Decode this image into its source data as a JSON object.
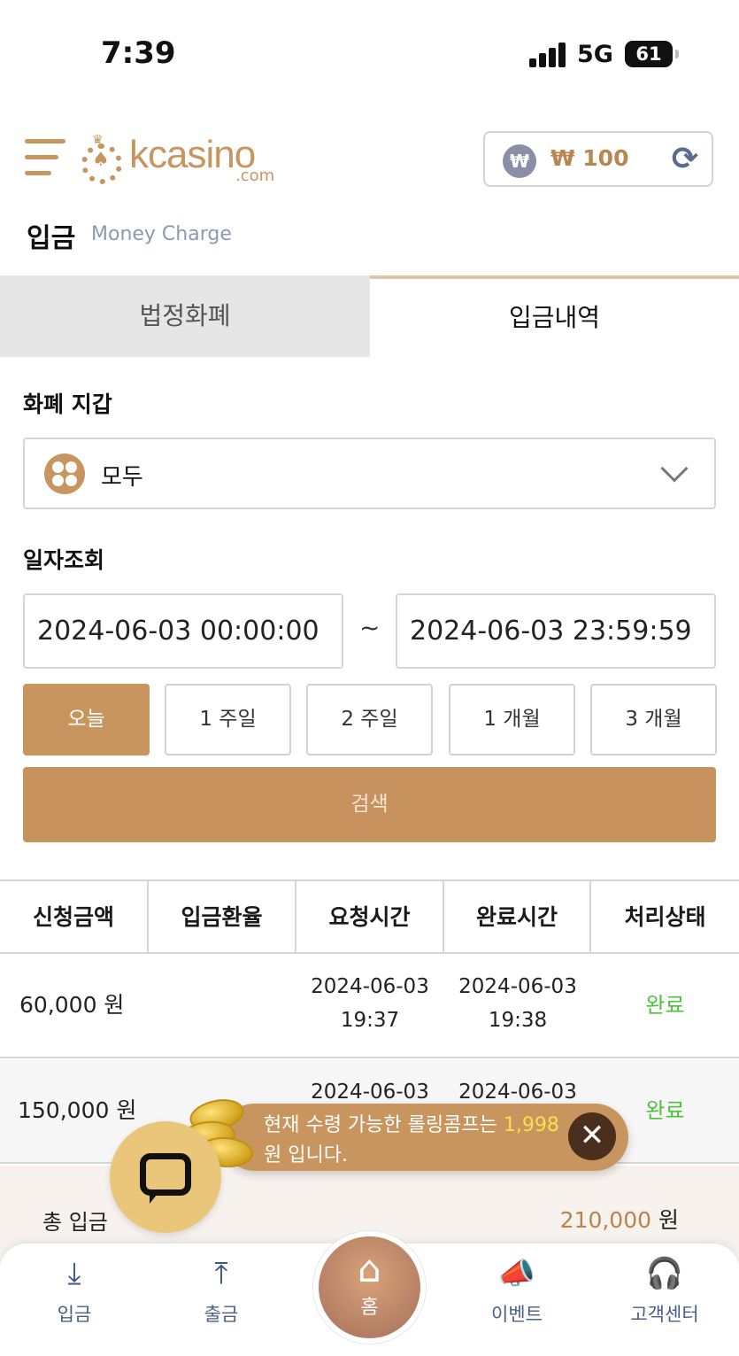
{
  "status_bar": {
    "time": "7:39",
    "network": "5G",
    "battery": "61"
  },
  "header": {
    "logo_text": "kcasino",
    "logo_sub": ".com",
    "balance_currency_symbol": "₩",
    "balance": "₩ 100"
  },
  "page": {
    "title": "입금",
    "subtitle": "Money Charge"
  },
  "tabs": [
    {
      "label": "법정화폐",
      "active": false
    },
    {
      "label": "입금내역",
      "active": true
    }
  ],
  "wallet": {
    "label": "화폐 지갑",
    "selected": "모두"
  },
  "date_filter": {
    "label": "일자조회",
    "start": "2024-06-03 00:00:00",
    "separator": "~",
    "end": "2024-06-03 23:59:59"
  },
  "quick_ranges": [
    "오늘",
    "1 주일",
    "2 주일",
    "1 개월",
    "3 개월"
  ],
  "quick_range_active_index": 0,
  "search_label": "검색",
  "table": {
    "headers": [
      "신청금액",
      "입금환율",
      "요청시간",
      "완료시간",
      "처리상태"
    ],
    "rows": [
      {
        "amount": "60,000 원",
        "rate": "",
        "request_date": "2024-06-03",
        "request_time": "19:37",
        "complete_date": "2024-06-03",
        "complete_time": "19:38",
        "status": "완료"
      },
      {
        "amount": "150,000 원",
        "rate": "",
        "request_date": "2024-06-03",
        "request_time": "",
        "complete_date": "2024-06-03",
        "complete_time": "",
        "status": "완료"
      }
    ]
  },
  "total": {
    "label": "총 입금",
    "value": "210,000",
    "unit": "원"
  },
  "toast": {
    "text_before": "현재 수령 가능한 롤링콤프는 ",
    "highlight": "1,998",
    "text_after": "원 입니다."
  },
  "bottom_nav": [
    {
      "label": "입금",
      "icon": "deposit-icon"
    },
    {
      "label": "출금",
      "icon": "withdraw-icon"
    },
    {
      "label": "홈",
      "icon": "home-icon"
    },
    {
      "label": "이벤트",
      "icon": "megaphone-icon"
    },
    {
      "label": "고객센터",
      "icon": "headset-icon"
    }
  ],
  "colors": {
    "accent": "#c8955f",
    "status_complete": "#4cc33a",
    "highlight": "#f9e04b"
  }
}
